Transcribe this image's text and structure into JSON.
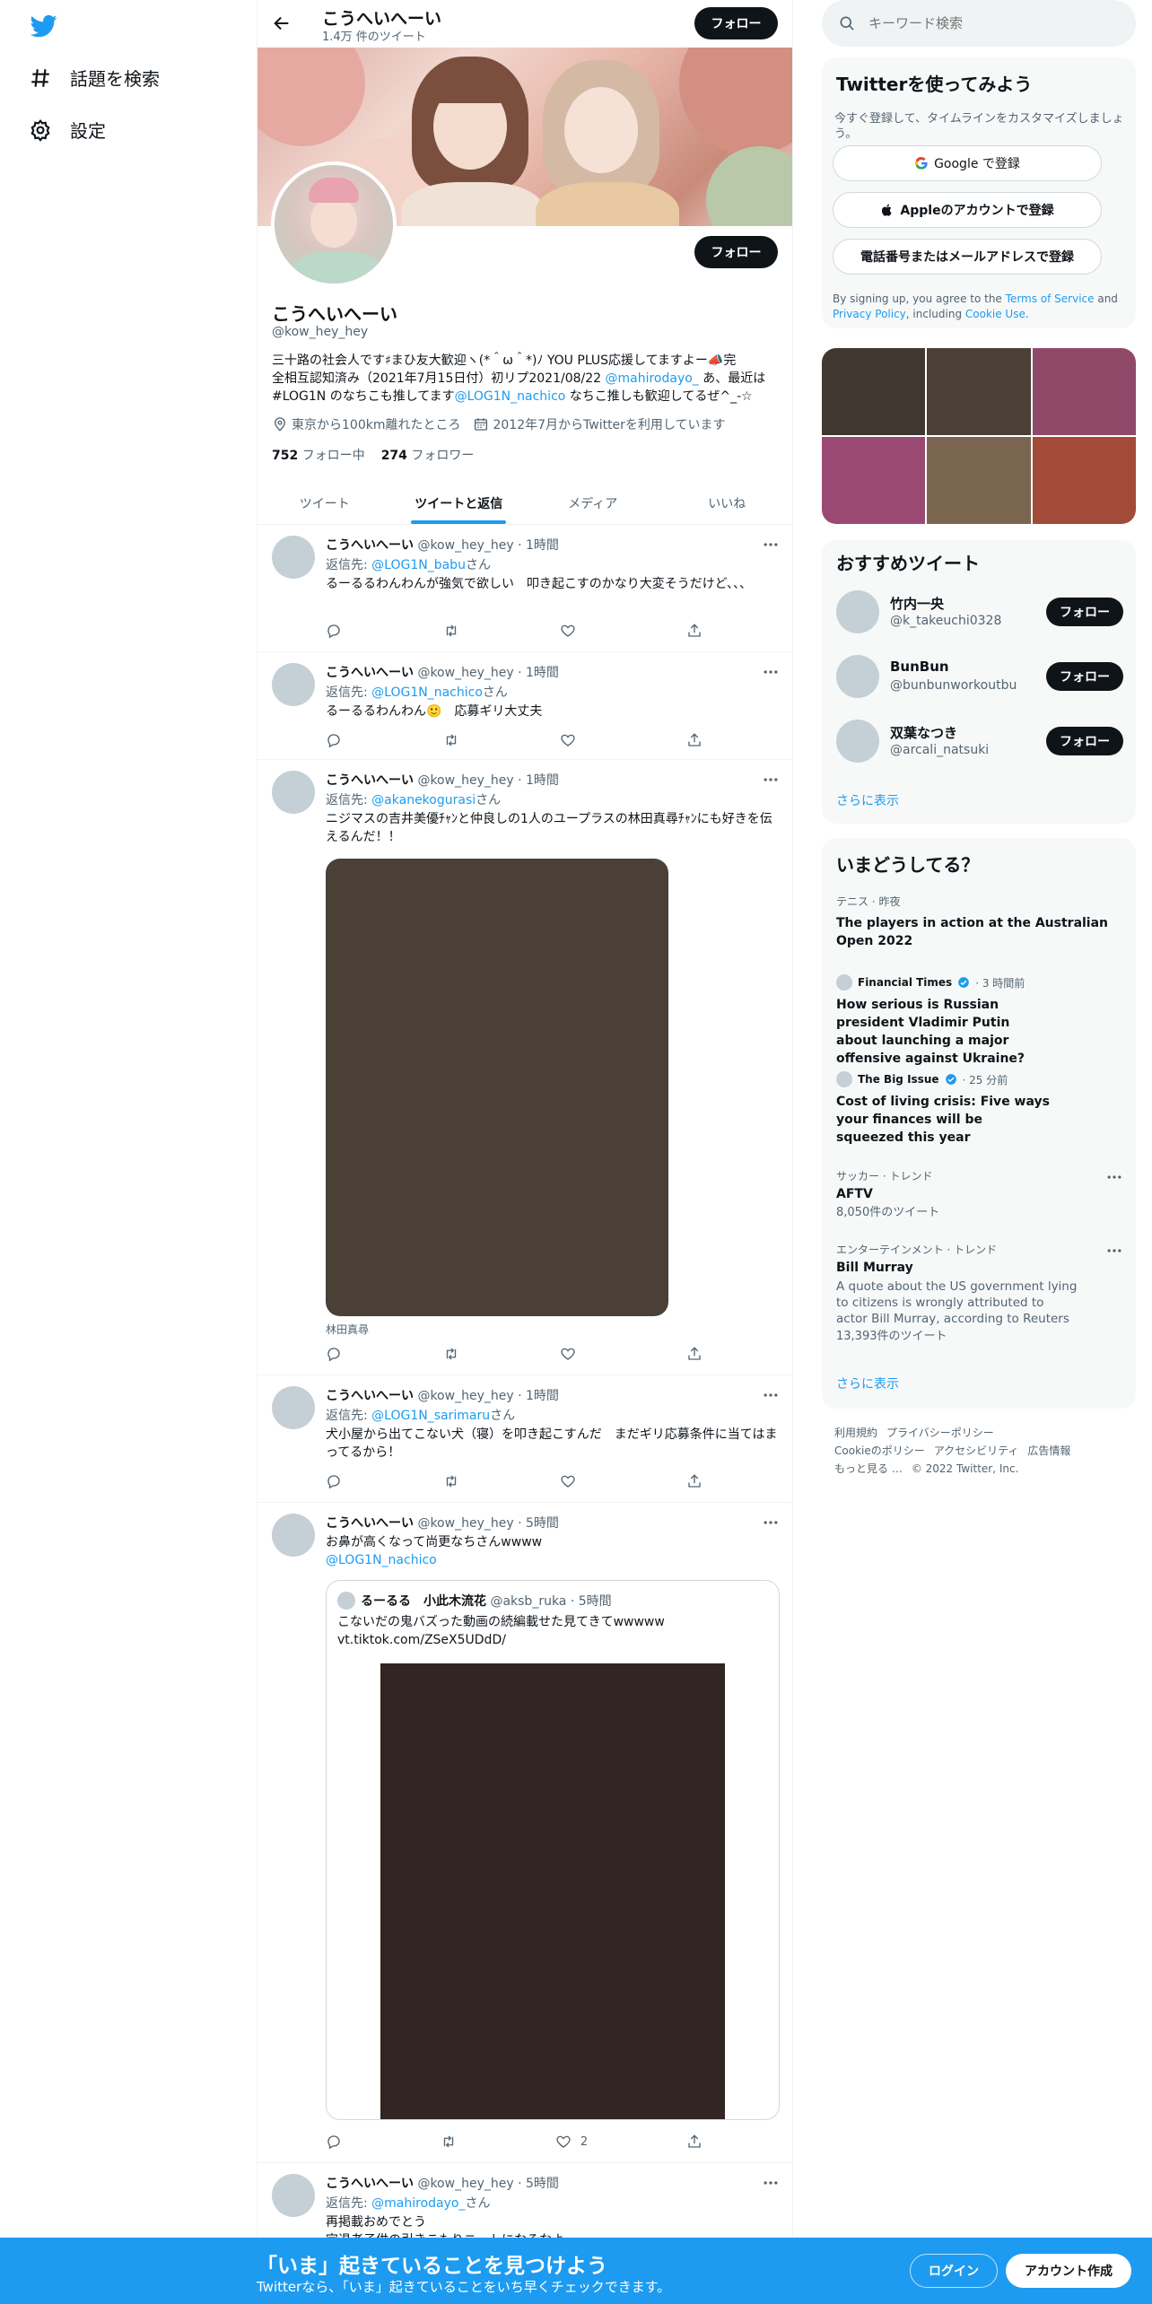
{
  "nav": {
    "explore_label": "話題を検索",
    "settings_label": "設定"
  },
  "header": {
    "name": "こうへいへーい",
    "tweet_count": "1.4万 件のツイート",
    "follow_label": "フォロー"
  },
  "profile": {
    "name": "こうへいへーい",
    "handle": "@kow_hey_hey",
    "follow_label": "フォロー",
    "bio_line1": "三十路の社会人です♯まひ友大歓迎ヽ(*＾ω＾*)ﾉ YOU PLUS応援してますよー📣完",
    "bio_line2_pre": "全相互認知済み（2021年7月15日付）初リプ2021/08/22 ",
    "bio_mention1": "@mahirodayo_",
    "bio_line2_post": " あ、最近は",
    "bio_line3_pre": "#LOG1N のなちこも推してます",
    "bio_mention2": "@LOG1N_nachico",
    "bio_line3_post": " なちこ推しも歓迎してるぜ^_-☆",
    "location": "東京から100km離れたところ",
    "joined": "2012年7月からTwitterを利用しています",
    "following_count": "752",
    "following_label": "フォロー中",
    "followers_count": "274",
    "followers_label": "フォロワー"
  },
  "tabs": [
    "ツイート",
    "ツイートと返信",
    "メディア",
    "いいね"
  ],
  "tweets": [
    {
      "name": "こうへいへーい",
      "handle": "@kow_hey_hey",
      "time": "· 1時間",
      "reply_prefix": "返信先: ",
      "reply_to": "@LOG1N_babu",
      "reply_suffix": "さん",
      "text": "るーるるわんわんが強気で欲しい　叩き起こすのかなり大変そうだけど、、、",
      "like_count": ""
    },
    {
      "name": "こうへいへーい",
      "handle": "@kow_hey_hey",
      "time": "· 1時間",
      "reply_prefix": "返信先: ",
      "reply_to": "@LOG1N_nachico",
      "reply_suffix": "さん",
      "text": "るーるるわんわん🙂　応募ギリ大丈夫",
      "like_count": ""
    },
    {
      "name": "こうへいへーい",
      "handle": "@kow_hey_hey",
      "time": "· 1時間",
      "reply_prefix": "返信先: ",
      "reply_to": "@akanekogurasi",
      "reply_suffix": "さん",
      "text": "ニジマスの吉井美優ﾁｬﾝと仲良しの1人のユープラスの林田真尋ﾁｬﾝにも好きを伝えるんだ！！",
      "caption": "林田真尋",
      "like_count": ""
    },
    {
      "name": "こうへいへーい",
      "handle": "@kow_hey_hey",
      "time": "· 1時間",
      "reply_prefix": "返信先: ",
      "reply_to": "@LOG1N_sarimaru",
      "reply_suffix": "さん",
      "text": "犬小屋から出てこない犬（寝）を叩き起こすんだ　まだギリ応募条件に当てはまってるから！",
      "like_count": ""
    },
    {
      "name": "こうへいへーい",
      "handle": "@kow_hey_hey",
      "time": "· 5時間",
      "text": "お鼻が高くなって尚更なちさんwwww",
      "mention": "@LOG1N_nachico",
      "quote": {
        "name": "るーるる　小此木流花",
        "handle": "@aksb_ruka",
        "time": "· 5時間",
        "text1": "こないだの鬼バズった動画の続編載せた見てきてwwwww",
        "text2": "vt.tiktok.com/ZSeX5UDdD/"
      },
      "like_count": "2"
    },
    {
      "name": "こうへいへーい",
      "handle": "@kow_hey_hey",
      "time": "· 5時間",
      "reply_prefix": "返信先: ",
      "reply_to": "@mahirodayo_",
      "reply_suffix": "さん",
      "text": "再掲載おめでとう",
      "text2": "定退老子供の引きこもりニートになるなよ"
    }
  ],
  "right": {
    "search_placeholder": "キーワード検索",
    "signup": {
      "title": "Twitterを使ってみよう",
      "subtitle": "今すぐ登録して、タイムラインをカスタマイズしましょう。",
      "google": "Google で登録",
      "apple": "Appleのアカウントで登録",
      "phone": "電話番号またはメールアドレスで登録",
      "terms_pre": "By signing up, you agree to the ",
      "terms_tos": "Terms of Service",
      "terms_mid": " and ",
      "terms_pp": "Privacy Policy",
      "terms_inc": ", including ",
      "terms_cookie": "Cookie Use",
      "terms_end": "."
    },
    "photo_colors": [
      "#3f3730",
      "#4a4038",
      "#8f4a6a",
      "#9a4a72",
      "#7a6650",
      "#a34a38"
    ],
    "recommend": {
      "title": "おすすめツイート",
      "items": [
        {
          "name": "竹内一央",
          "handle": "@k_takeuchi0328"
        },
        {
          "name": "BunBun",
          "handle": "@bunbunworkoutbu"
        },
        {
          "name": "双葉なつき",
          "handle": "@arcali_natsuki"
        }
      ],
      "follow_label": "フォロー",
      "more": "さらに表示"
    },
    "trends": {
      "title": "いまどうしてる？",
      "items": [
        {
          "category": "テニス · 昨夜",
          "title": "The players in action at the Australian Open 2022"
        },
        {
          "category": "Financial Times",
          "time": "· 3 時間前",
          "title": "How serious is Russian president Vladimir Putin about launching a major offensive against Ukraine?"
        },
        {
          "category": "The Big Issue",
          "time": "· 25 分前",
          "title": "Cost of living crisis: Five ways your finances will be squeezed this year"
        },
        {
          "category": "サッカー · トレンド",
          "title": "AFTV",
          "sub": "8,050件のツイート"
        },
        {
          "category": "エンターテインメント · トレンド",
          "title": "Bill Murray",
          "desc": "A quote about the US government lying to citizens is wrongly attributed to actor Bill Murray, according to Reuters",
          "sub": "13,393件のツイート"
        }
      ],
      "more": "さらに表示"
    },
    "footer": {
      "terms": "利用規約",
      "privacy": "プライバシーポリシー",
      "cookie": "Cookieのポリシー",
      "access": "アクセシビリティ",
      "ads": "広告情報",
      "more": "もっと見る …",
      "copyright": "© 2022 Twitter, Inc."
    }
  },
  "bottom_bar": {
    "title": "「いま」起きていることを見つけよう",
    "subtitle": "Twitterなら、「いま」起きていることをいち早くチェックできます。",
    "login": "ログイン",
    "signup": "アカウント作成"
  }
}
